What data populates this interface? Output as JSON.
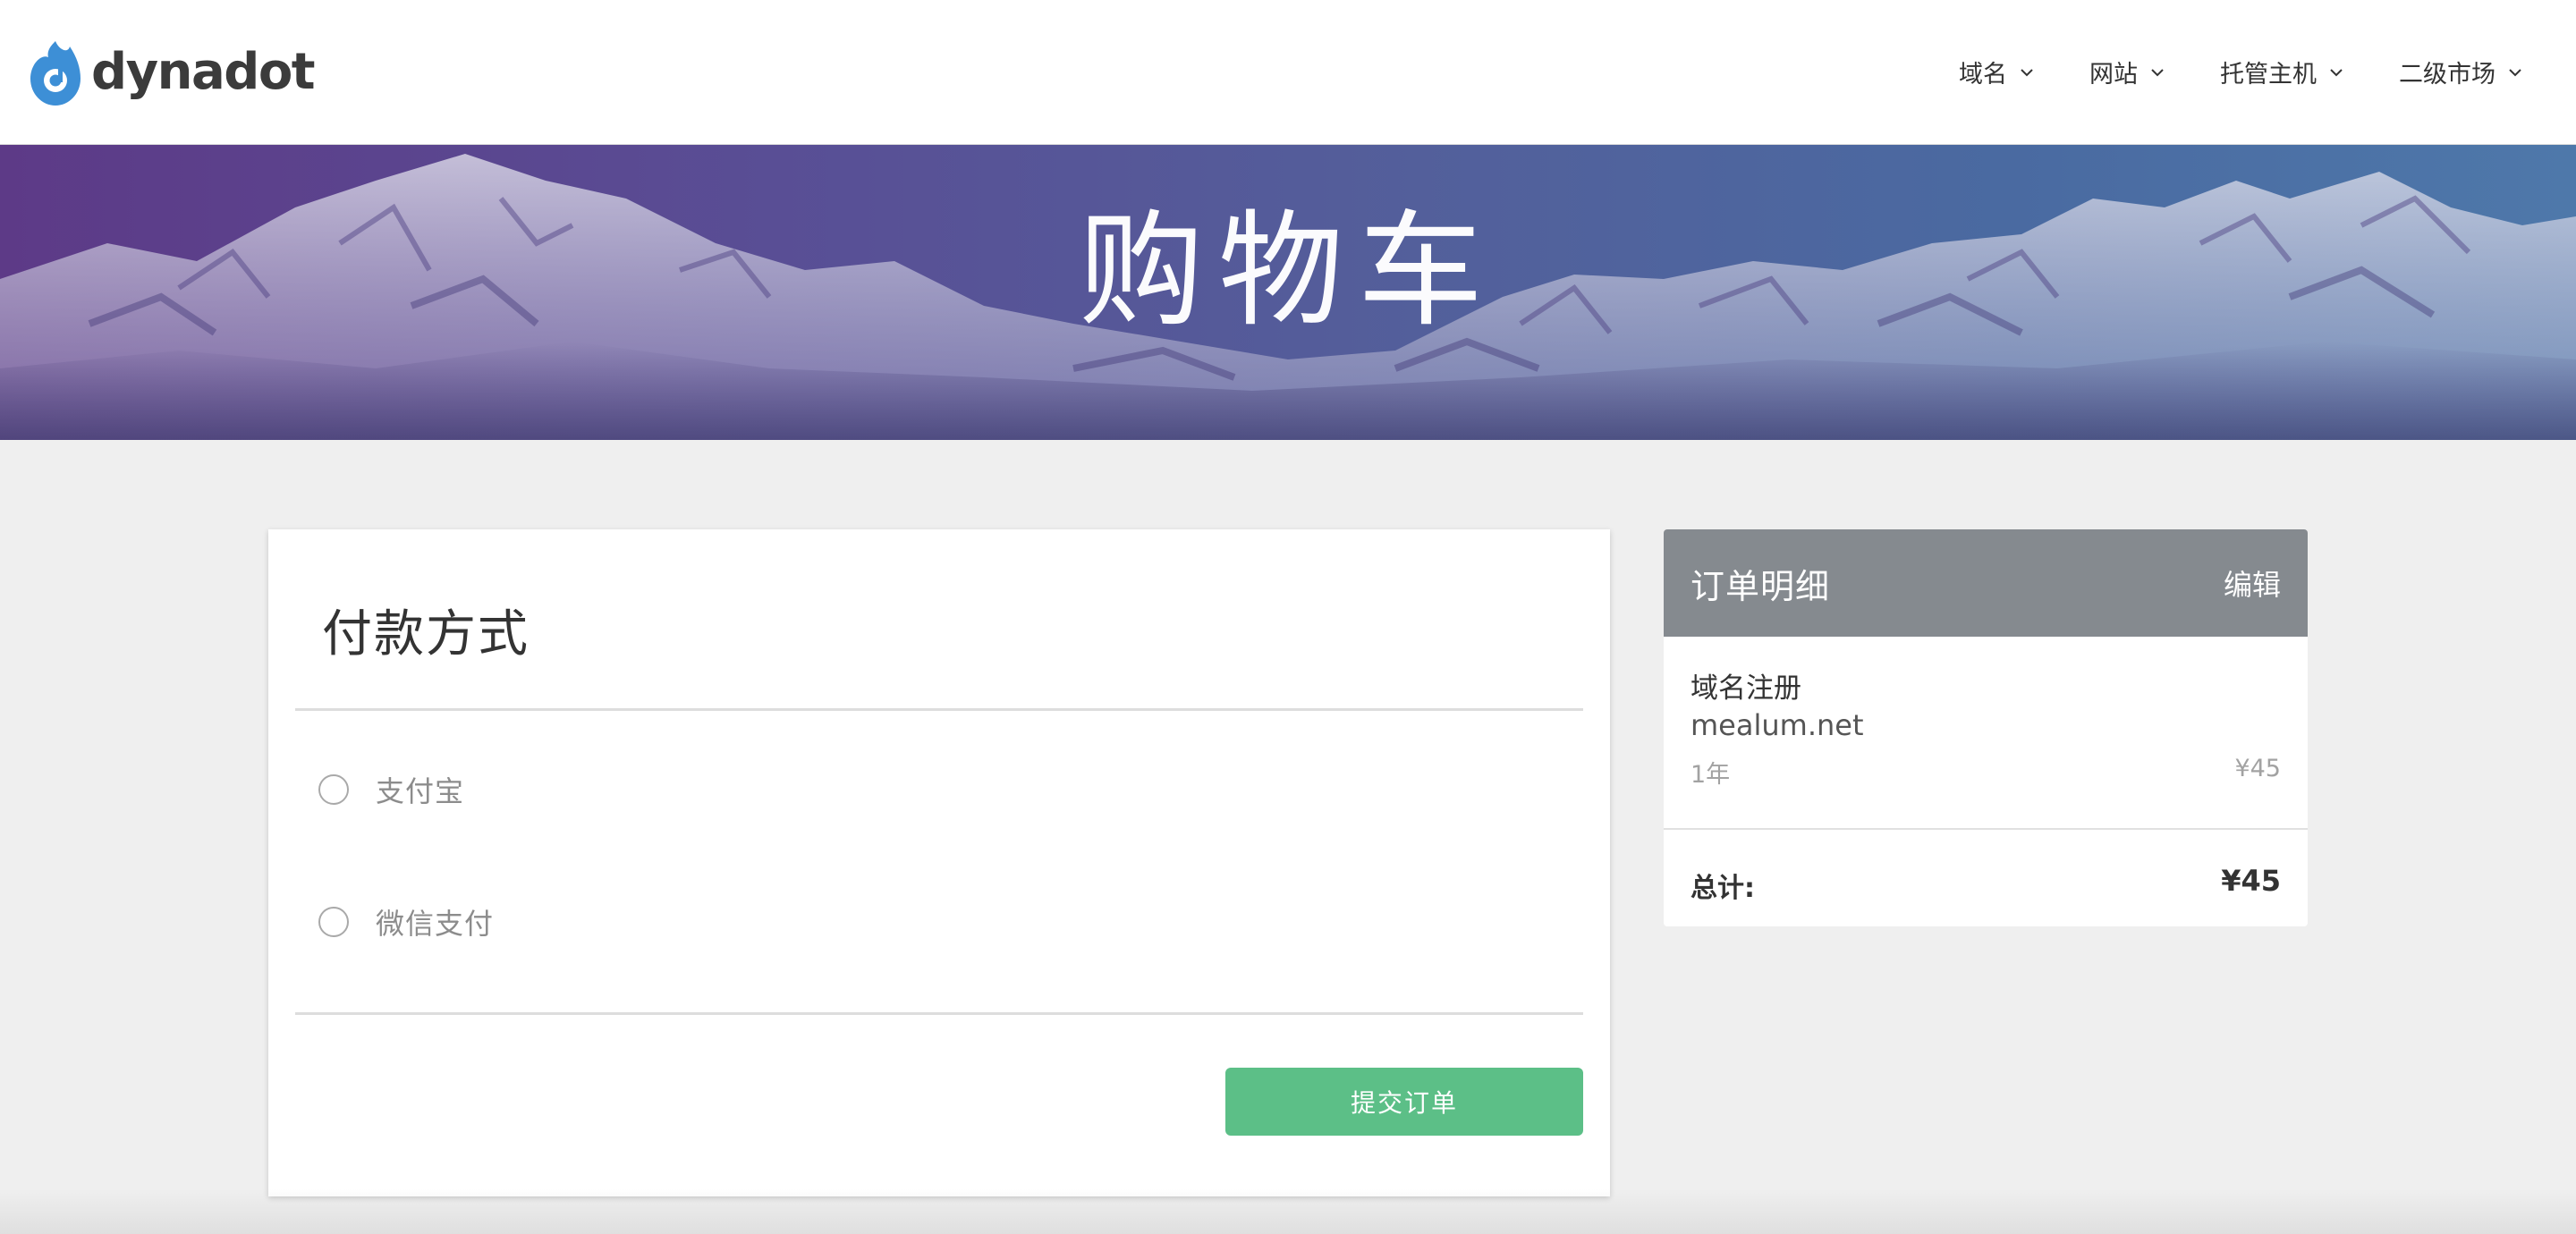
{
  "header": {
    "brand_name": "dynadot",
    "logo_icon": "dynadot-flame-logo-icon",
    "nav_items": [
      {
        "label": "域名",
        "icon": "chevron-down-icon"
      },
      {
        "label": "网站",
        "icon": "chevron-down-icon"
      },
      {
        "label": "托管主机",
        "icon": "chevron-down-icon"
      },
      {
        "label": "二级市场",
        "icon": "chevron-down-icon"
      }
    ]
  },
  "hero": {
    "title": "购物车"
  },
  "payment": {
    "title": "付款方式",
    "options": [
      {
        "label": "支付宝",
        "selected": false
      },
      {
        "label": "微信支付",
        "selected": false
      }
    ],
    "submit_label": "提交订单"
  },
  "order": {
    "title": "订单明细",
    "edit_label": "编辑",
    "item": {
      "type": "域名注册",
      "domain": "mealum.net",
      "term": "1年",
      "price": "¥45"
    },
    "total_label": "总计:",
    "total_value": "¥45"
  },
  "colors": {
    "logo_blue": "#3d8fd6",
    "submit_green": "#5cbf87",
    "order_header_gray": "#858a8f",
    "page_background": "#efefef",
    "hero_purple": "#5d3a87",
    "hero_blue": "#4e78aa"
  }
}
